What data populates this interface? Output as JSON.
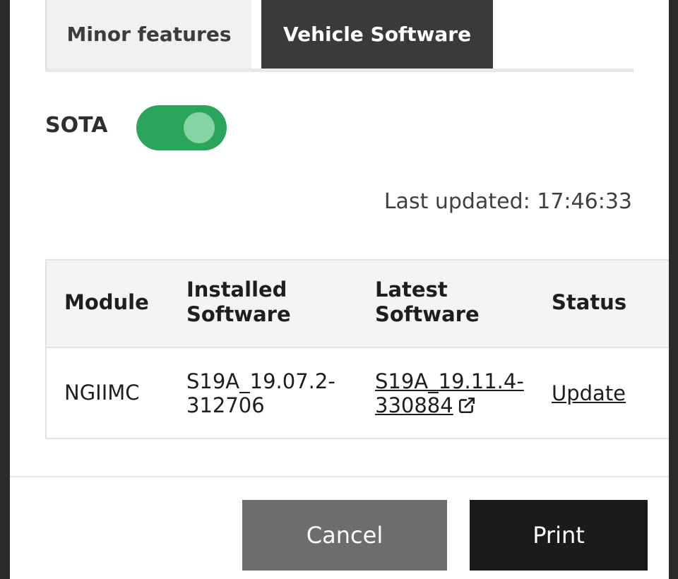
{
  "tabs": {
    "minor_features": "Minor features",
    "vehicle_software": "Vehicle Software",
    "active": "Vehicle Software"
  },
  "sota": {
    "label": "SOTA",
    "enabled": true
  },
  "last_updated": "Last updated: 17:46:33",
  "table": {
    "headers": {
      "module": "Module",
      "installed_line1": "Installed",
      "installed_line2": "Software",
      "latest_line1": "Latest",
      "latest_line2": "Software",
      "status": "Status"
    },
    "rows": [
      {
        "module": "NGIIMC",
        "installed_line1": "S19A_19.07.2-",
        "installed_line2": "312706",
        "latest_line1": "S19A_19.11.4-",
        "latest_line2": "330884",
        "status": "Update"
      }
    ]
  },
  "buttons": {
    "cancel": "Cancel",
    "print": "Print"
  },
  "colors": {
    "toggle_on": "#2ba55c",
    "active_tab": "#3a3a3a",
    "print_button": "#1b1b1b",
    "cancel_button": "#6d6d6d"
  },
  "icons": {
    "external_link": "external-link-icon"
  }
}
